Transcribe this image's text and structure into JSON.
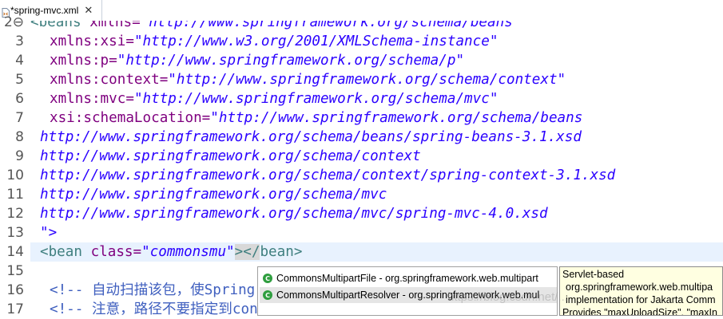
{
  "tab": {
    "title": "*spring-mvc.xml",
    "close_glyph": "✕",
    "icon": "xml-file-icon"
  },
  "colors": {
    "tag": "#3f7f7f",
    "attr": "#7f007f",
    "value": "#2a00ff",
    "comment": "#3f5fbf",
    "current_line": "#e8f2fe"
  },
  "gutter": {
    "line_numbers": [
      "2⊖",
      "3",
      "4",
      "5",
      "6",
      "7",
      "8",
      "9",
      "10",
      "11",
      "12",
      "13",
      "14",
      "15",
      "16",
      "17"
    ]
  },
  "code": {
    "l2": {
      "tag": "<beans",
      "attr": "xmlns=",
      "val": "\"http://www.springframework.org/schema/beans\""
    },
    "l3": {
      "attr": "xmlns:xsi=",
      "val": "\"http://www.w3.org/2001/XMLSchema-instance\""
    },
    "l4": {
      "attr": "xmlns:p=",
      "val": "\"http://www.springframework.org/schema/p\""
    },
    "l5": {
      "attr": "xmlns:context=",
      "val": "\"http://www.springframework.org/schema/context\""
    },
    "l6": {
      "attr": "xmlns:mvc=",
      "val": "\"http://www.springframework.org/schema/mvc\""
    },
    "l7": {
      "attr": "xsi:schemaLocation=",
      "val": "\"http://www.springframework.org/schema/beans"
    },
    "l8": {
      "val": "http://www.springframework.org/schema/beans/spring-beans-3.1.xsd"
    },
    "l9": {
      "val": "http://www.springframework.org/schema/context"
    },
    "l10": {
      "val": "http://www.springframework.org/schema/context/spring-context-3.1.xsd"
    },
    "l11": {
      "val": "http://www.springframework.org/schema/mvc"
    },
    "l12": {
      "val": "http://www.springframework.org/schema/mvc/spring-mvc-4.0.xsd"
    },
    "l13": {
      "val": "\">"
    },
    "l14": {
      "open": "<",
      "tag": "bean",
      "attr": "class=",
      "val": "\"commonsmu\"",
      "close": "></",
      "end_tag": "bean",
      "end": ">"
    },
    "l16": {
      "comment": "<!-- 自动扫描该包，使Spring"
    },
    "l17": {
      "comment": "<!-- 注意，路径不要指定到con"
    }
  },
  "autocomplete": {
    "items": [
      {
        "label": "CommonsMultipartFile - org.springframework.web.multipart",
        "icon": "class-icon"
      },
      {
        "label": "CommonsMultipartResolver - org.springframework.web.mul",
        "icon": "class-icon"
      }
    ]
  },
  "doc_popup": {
    "lines": [
      "Servlet-based",
      "org.springframework.web.multipa",
      "implementation for Jakarta Comm",
      "Provides \"maxUploadSize\", \"maxIn"
    ]
  },
  "watermark": "https://blog.csdn.net/..."
}
